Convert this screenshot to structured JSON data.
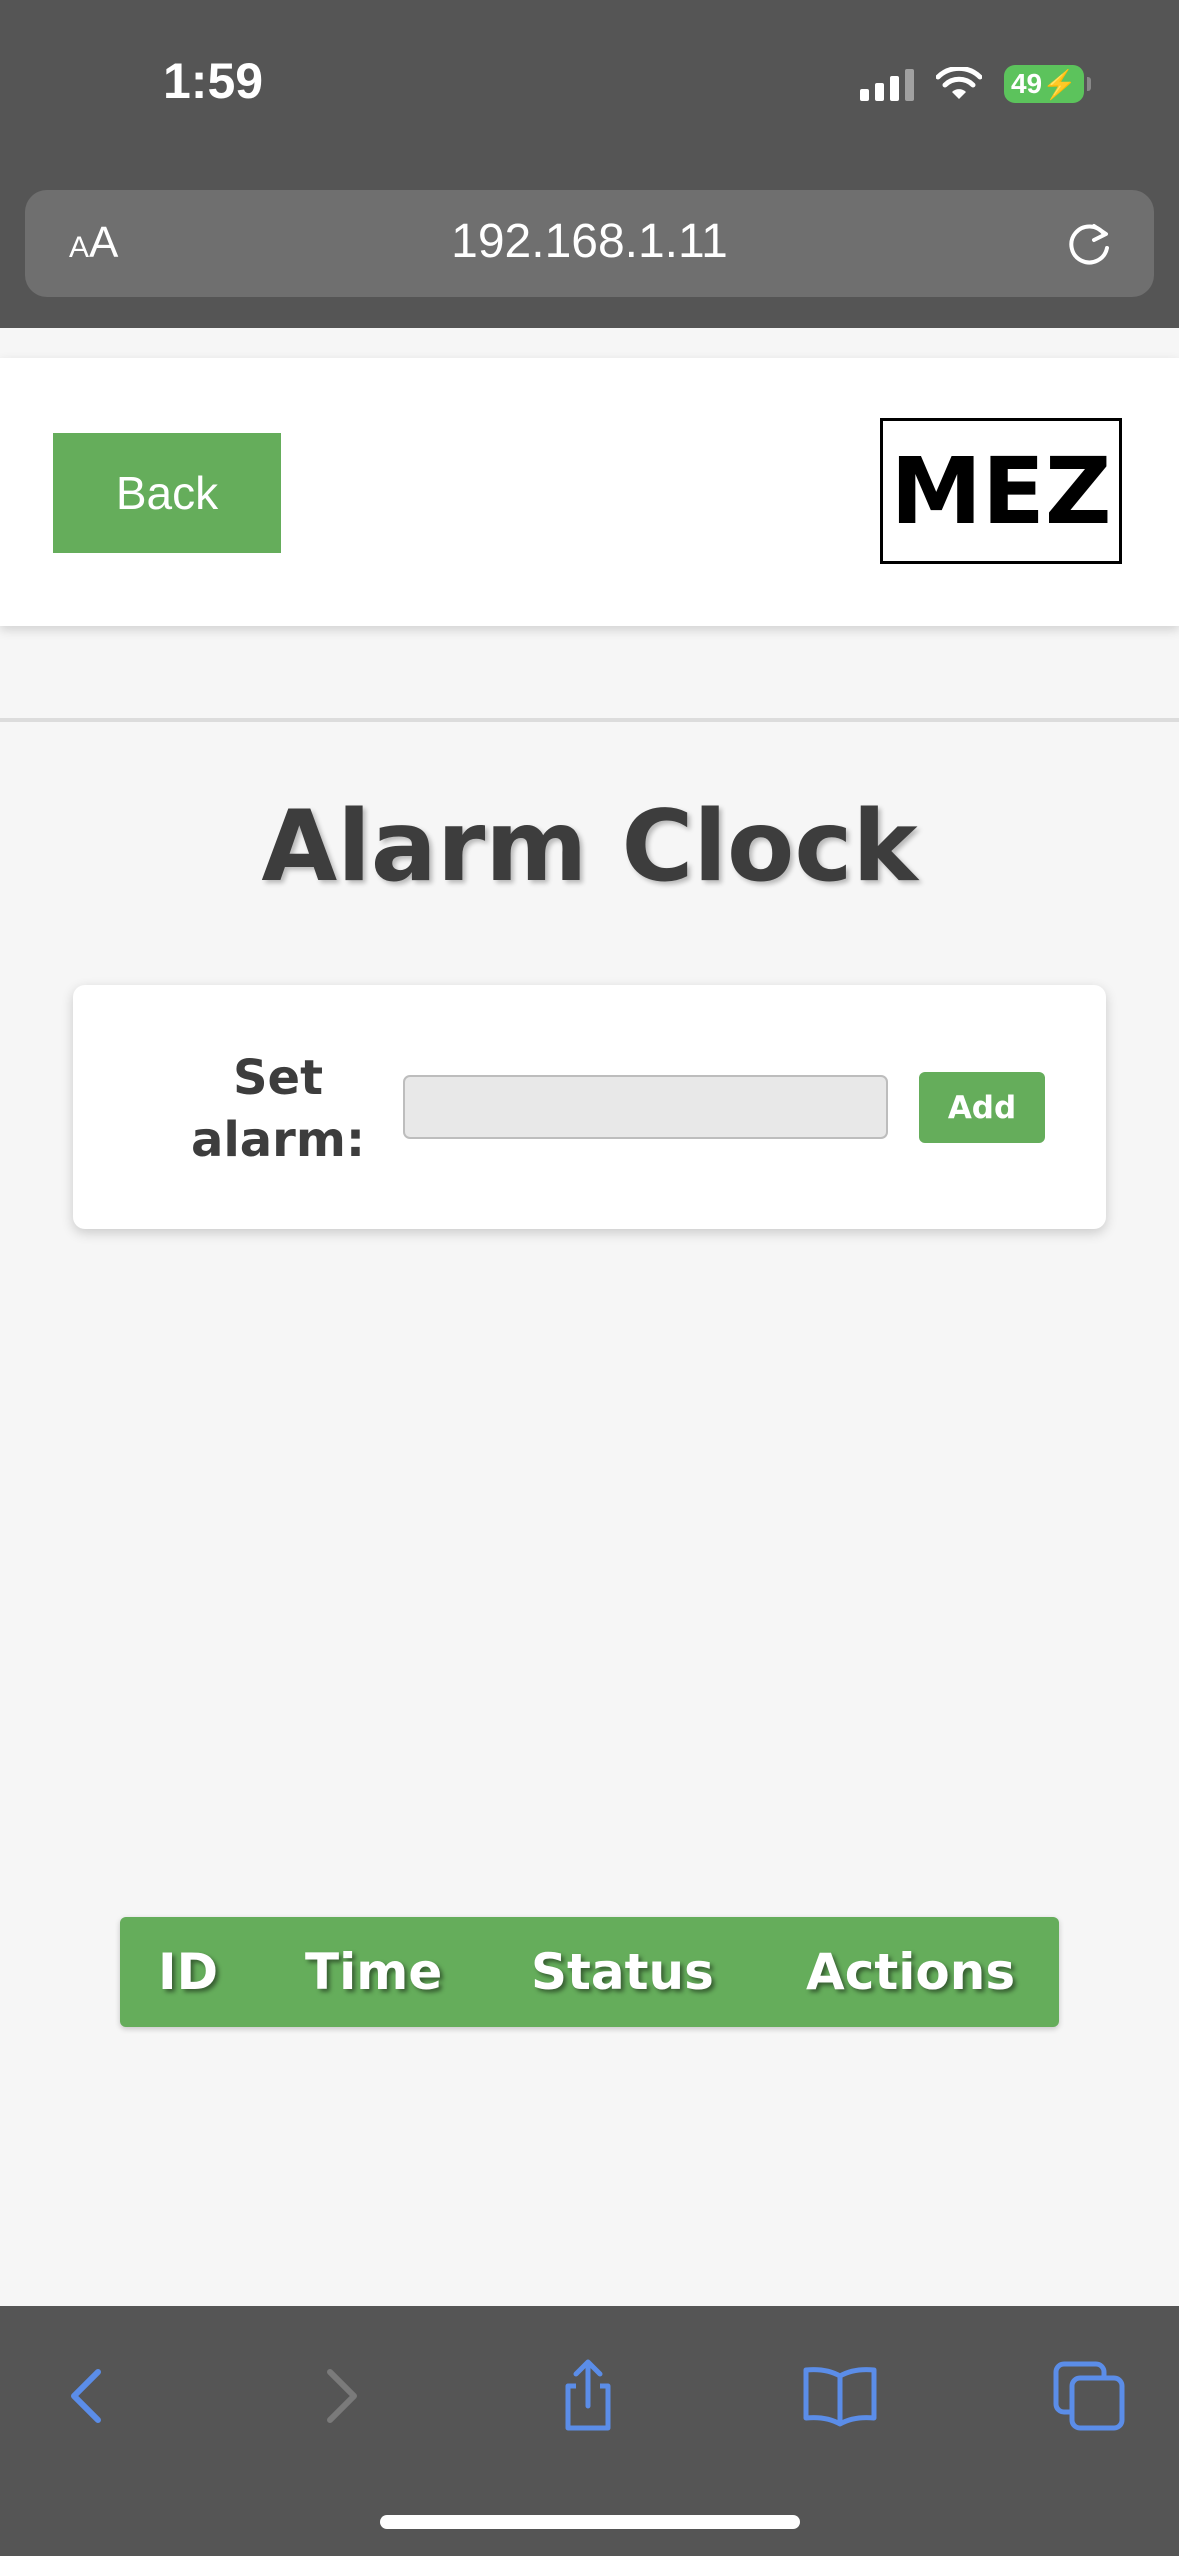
{
  "status_bar": {
    "time": "1:59",
    "battery": "49"
  },
  "browser": {
    "text_size_small": "A",
    "text_size_big": "A",
    "url": "192.168.1.11"
  },
  "header": {
    "back_label": "Back",
    "logo_text": "MEZ"
  },
  "page": {
    "title": "Alarm Clock"
  },
  "alarm_form": {
    "label": "Set alarm:",
    "input_value": "",
    "add_label": "Add"
  },
  "table": {
    "columns": [
      "ID",
      "Time",
      "Status",
      "Actions"
    ],
    "rows": []
  },
  "colors": {
    "accent": "#65ad5b",
    "chrome": "#555555",
    "ios_blue": "#5b8de8"
  }
}
